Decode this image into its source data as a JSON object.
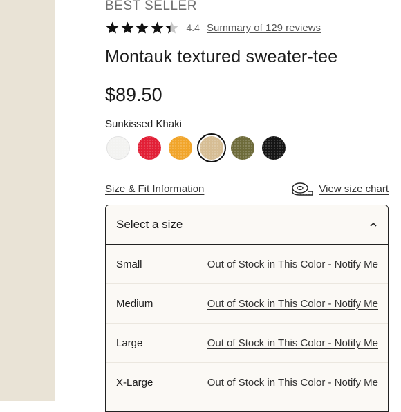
{
  "product": {
    "badge": "BEST SELLER",
    "rating": {
      "value": "4.4",
      "stars": 4.4,
      "reviews_link": "Summary of 129 reviews"
    },
    "title": "Montauk textured sweater-tee",
    "price": "$89.50",
    "selected_color": "Sunkissed Khaki"
  },
  "swatches": [
    {
      "name": "white-swatch",
      "color": "#f3f3f1"
    },
    {
      "name": "red-swatch",
      "color": "#e21f36"
    },
    {
      "name": "yellow-swatch",
      "color": "#f1a52a"
    },
    {
      "name": "khaki-swatch",
      "color": "#d6bd94",
      "selected": true
    },
    {
      "name": "olive-swatch",
      "color": "#6e6b3a"
    },
    {
      "name": "black-swatch",
      "color": "#151515"
    }
  ],
  "links": {
    "size_fit": "Size & Fit Information",
    "size_chart": "View size chart"
  },
  "size_select": {
    "label": "Select a size",
    "options": [
      {
        "size": "Small",
        "status": "Out of Stock in This Color - Notify Me"
      },
      {
        "size": "Medium",
        "status": "Out of Stock in This Color - Notify Me"
      },
      {
        "size": "Large",
        "status": "Out of Stock in This Color - Notify Me"
      },
      {
        "size": "X-Large",
        "status": "Out of Stock in This Color - Notify Me"
      }
    ]
  },
  "icons": {
    "star": "star-icon",
    "tape": "measuring-tape-icon",
    "chevron": "chevron-up-icon"
  }
}
